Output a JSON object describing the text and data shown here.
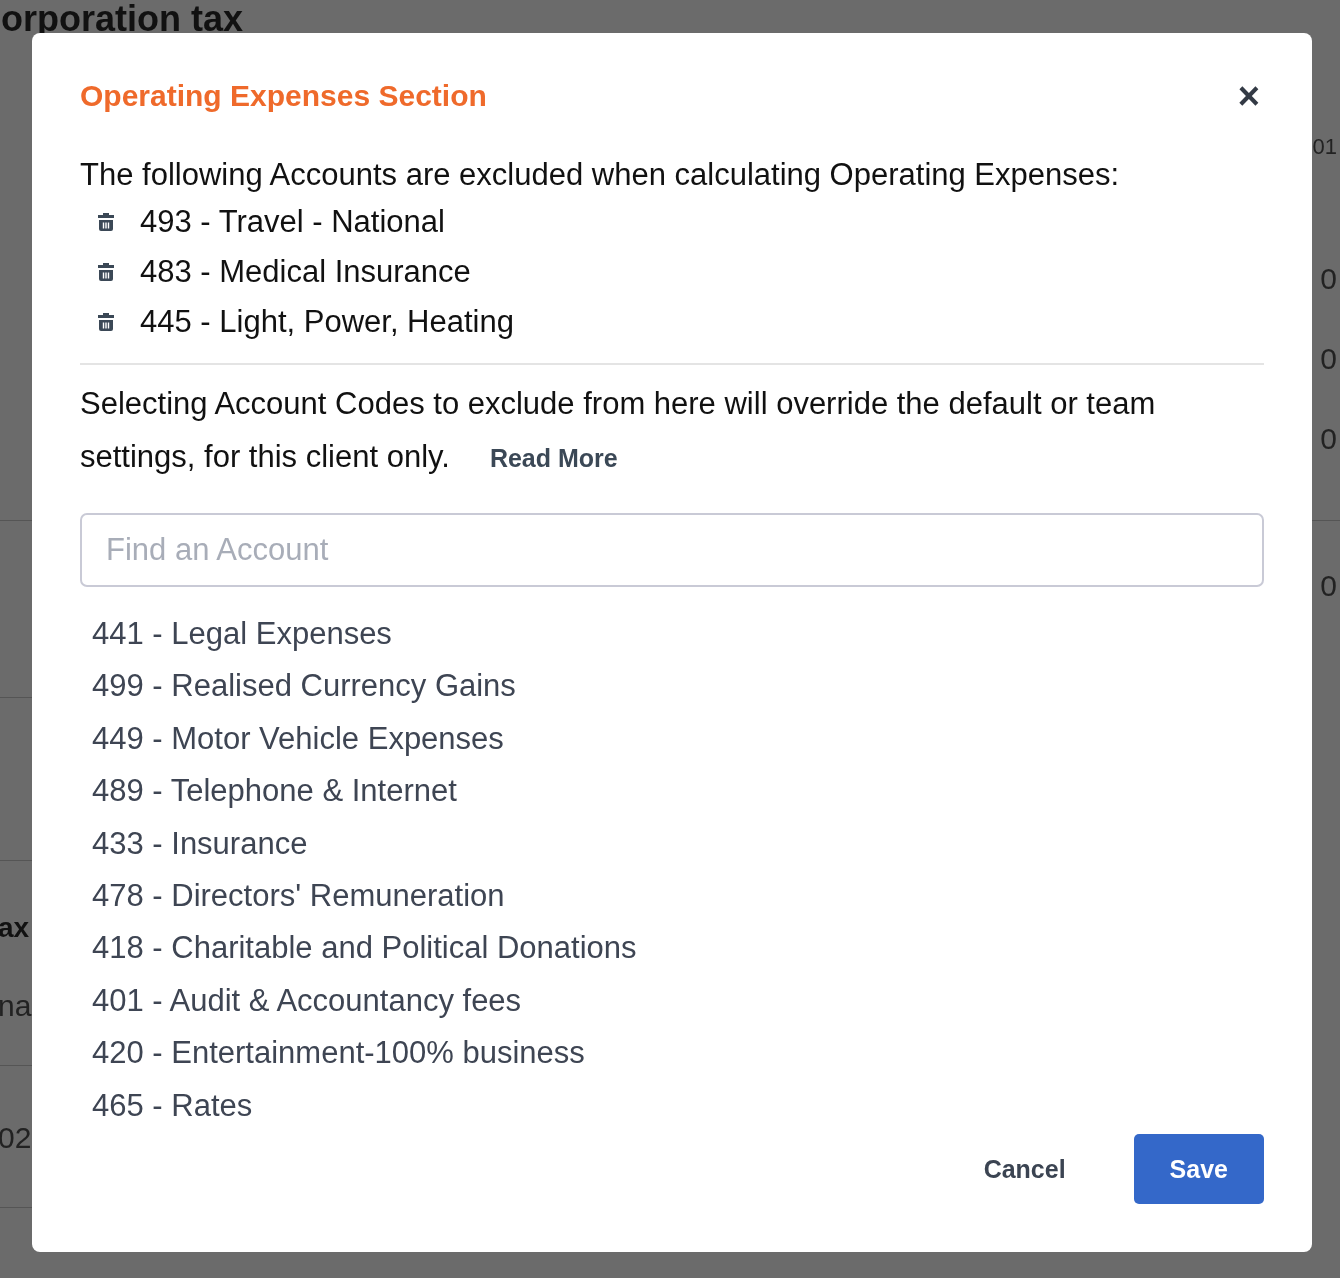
{
  "background": {
    "heading": "orporation tax",
    "right_fragments": [
      {
        "text": "01",
        "kind": "small"
      },
      {
        "text": "0",
        "kind": "value"
      },
      {
        "text": "0",
        "kind": "value"
      },
      {
        "text": "0",
        "kind": "value"
      },
      {
        "text": "0",
        "kind": "value"
      }
    ],
    "left_fragments": [
      {
        "text": "ax",
        "kind": "bold"
      },
      {
        "text": "na",
        "kind": "value"
      },
      {
        "text": "02",
        "kind": "value"
      }
    ]
  },
  "dialog": {
    "title": "Operating Expenses Section",
    "close": "×",
    "intro": "The following Accounts are excluded when calculating Operating Expenses:",
    "excluded": [
      "493 - Travel - National",
      "483 - Medical Insurance",
      "445 - Light, Power, Heating"
    ],
    "note": "Selecting Account Codes to exclude from here will override the default or team settings, for this client only.",
    "read_more": "Read More",
    "search": {
      "placeholder": "Find an Account"
    },
    "accounts": [
      "441 - Legal Expenses",
      "499 - Realised Currency Gains",
      "449 - Motor Vehicle Expenses",
      "489 - Telephone & Internet",
      "433 - Insurance",
      "478 - Directors' Remuneration",
      "418 - Charitable and Political Donations",
      "401 - Audit & Accountancy fees",
      "420 - Entertainment-100% business",
      "465 - Rates"
    ],
    "buttons": [
      {
        "label": "Cancel",
        "kind": "secondary"
      },
      {
        "label": "Save",
        "kind": "primary"
      }
    ]
  }
}
